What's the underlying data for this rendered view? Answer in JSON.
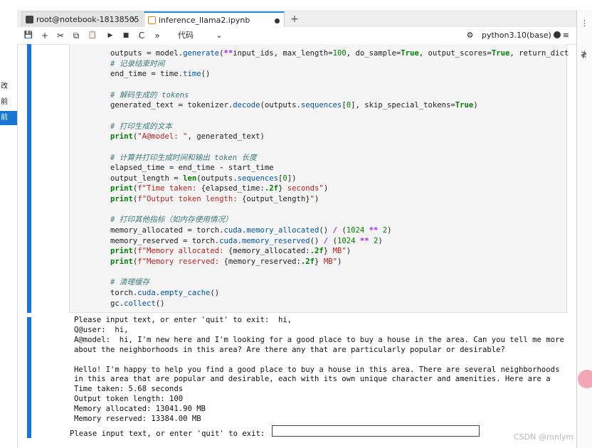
{
  "left_panel": {
    "items": [
      "改",
      "前",
      "前"
    ]
  },
  "tabs": [
    {
      "label": "root@notebook-18138505",
      "close": "×"
    },
    {
      "label": "inference_llama2.ipynb"
    }
  ],
  "new_tab_label": "+",
  "toolbar": {
    "save": "💾",
    "add": "+",
    "cut": "✂",
    "copy": "⧉",
    "paste": "📋",
    "run": "▶",
    "stop": "■",
    "restart": "C",
    "run_all": "»",
    "cell_type": "代码",
    "cell_type_arrow": "⌄",
    "kernel_icon": "⚙",
    "kernel_name": "python3.10(base)",
    "menu": "≡"
  },
  "right_edge": {
    "glyph1": "⋮",
    "glyph2": "≹"
  },
  "code_lines": [
    {
      "segs": [
        {
          "t": "outputs = model."
        },
        {
          "t": "generate",
          "c": "fn"
        },
        {
          "t": "("
        },
        {
          "t": "**",
          "c": "op"
        },
        {
          "t": "input_ids, max_length="
        },
        {
          "t": "100",
          "c": "num"
        },
        {
          "t": ", do_sample="
        },
        {
          "t": "True",
          "c": "kw"
        },
        {
          "t": ", output_scores="
        },
        {
          "t": "True",
          "c": "kw"
        },
        {
          "t": ", return_dict"
        }
      ]
    },
    {
      "segs": [
        {
          "t": "# 记录结束时间",
          "c": "cmt"
        }
      ]
    },
    {
      "segs": [
        {
          "t": "end_time = time."
        },
        {
          "t": "time",
          "c": "fn"
        },
        {
          "t": "()"
        }
      ]
    },
    {
      "segs": []
    },
    {
      "segs": [
        {
          "t": "# 解码生成的 tokens",
          "c": "cmt"
        }
      ]
    },
    {
      "segs": [
        {
          "t": "generated_text = tokenizer."
        },
        {
          "t": "decode",
          "c": "fn"
        },
        {
          "t": "(outputs."
        },
        {
          "t": "sequences",
          "c": "fn"
        },
        {
          "t": "["
        },
        {
          "t": "0",
          "c": "num"
        },
        {
          "t": "], skip_special_tokens="
        },
        {
          "t": "True",
          "c": "kw"
        },
        {
          "t": ")"
        }
      ]
    },
    {
      "segs": []
    },
    {
      "segs": [
        {
          "t": "# 打印生成的文本",
          "c": "cmt"
        }
      ]
    },
    {
      "segs": [
        {
          "t": "print",
          "c": "kw"
        },
        {
          "t": "("
        },
        {
          "t": "\"A@model: \"",
          "c": "str"
        },
        {
          "t": ", generated_text)"
        }
      ]
    },
    {
      "segs": []
    },
    {
      "segs": [
        {
          "t": "# 计算并打印生成时间和输出 token 长度",
          "c": "cmt"
        }
      ]
    },
    {
      "segs": [
        {
          "t": "elapsed_time = end_time "
        },
        {
          "t": "-",
          "c": "op"
        },
        {
          "t": " start_time"
        }
      ]
    },
    {
      "segs": [
        {
          "t": "output_length = "
        },
        {
          "t": "len",
          "c": "kw"
        },
        {
          "t": "(outputs."
        },
        {
          "t": "sequences",
          "c": "fn"
        },
        {
          "t": "["
        },
        {
          "t": "0",
          "c": "num"
        },
        {
          "t": "])"
        }
      ]
    },
    {
      "segs": [
        {
          "t": "print",
          "c": "kw"
        },
        {
          "t": "("
        },
        {
          "t": "f\"Time taken: ",
          "c": "str"
        },
        {
          "t": "{elapsed_time:"
        },
        {
          "t": ".2f",
          "c": "kw"
        },
        {
          "t": "}"
        },
        {
          "t": " seconds\"",
          "c": "str"
        },
        {
          "t": ")"
        }
      ]
    },
    {
      "segs": [
        {
          "t": "print",
          "c": "kw"
        },
        {
          "t": "("
        },
        {
          "t": "f\"Output token length: ",
          "c": "str"
        },
        {
          "t": "{output_length}"
        },
        {
          "t": "\"",
          "c": "str"
        },
        {
          "t": ")"
        }
      ]
    },
    {
      "segs": []
    },
    {
      "segs": [
        {
          "t": "# 打印其他指标（如内存使用情况）",
          "c": "cmt"
        }
      ]
    },
    {
      "segs": [
        {
          "t": "memory_allocated = torch."
        },
        {
          "t": "cuda",
          "c": "fn"
        },
        {
          "t": "."
        },
        {
          "t": "memory_allocated",
          "c": "fn"
        },
        {
          "t": "() "
        },
        {
          "t": "/",
          "c": "op"
        },
        {
          "t": " ("
        },
        {
          "t": "1024",
          "c": "num"
        },
        {
          "t": " "
        },
        {
          "t": "**",
          "c": "op"
        },
        {
          "t": " "
        },
        {
          "t": "2",
          "c": "num"
        },
        {
          "t": ")"
        }
      ]
    },
    {
      "segs": [
        {
          "t": "memory_reserved = torch."
        },
        {
          "t": "cuda",
          "c": "fn"
        },
        {
          "t": "."
        },
        {
          "t": "memory_reserved",
          "c": "fn"
        },
        {
          "t": "() "
        },
        {
          "t": "/",
          "c": "op"
        },
        {
          "t": " ("
        },
        {
          "t": "1024",
          "c": "num"
        },
        {
          "t": " "
        },
        {
          "t": "**",
          "c": "op"
        },
        {
          "t": " "
        },
        {
          "t": "2",
          "c": "num"
        },
        {
          "t": ")"
        }
      ]
    },
    {
      "segs": [
        {
          "t": "print",
          "c": "kw"
        },
        {
          "t": "("
        },
        {
          "t": "f\"Memory allocated: ",
          "c": "str"
        },
        {
          "t": "{memory_allocated:"
        },
        {
          "t": ".2f",
          "c": "kw"
        },
        {
          "t": "}"
        },
        {
          "t": " MB\"",
          "c": "str"
        },
        {
          "t": ")"
        }
      ]
    },
    {
      "segs": [
        {
          "t": "print",
          "c": "kw"
        },
        {
          "t": "("
        },
        {
          "t": "f\"Memory reserved: ",
          "c": "str"
        },
        {
          "t": "{memory_reserved:"
        },
        {
          "t": ".2f",
          "c": "kw"
        },
        {
          "t": "}"
        },
        {
          "t": " MB\"",
          "c": "str"
        },
        {
          "t": ")"
        }
      ]
    },
    {
      "segs": []
    },
    {
      "segs": [
        {
          "t": "# 清理缓存",
          "c": "cmt"
        }
      ]
    },
    {
      "segs": [
        {
          "t": "torch."
        },
        {
          "t": "cuda",
          "c": "fn"
        },
        {
          "t": "."
        },
        {
          "t": "empty_cache",
          "c": "fn"
        },
        {
          "t": "()"
        }
      ]
    },
    {
      "segs": [
        {
          "t": "gc."
        },
        {
          "t": "collect",
          "c": "fn"
        },
        {
          "t": "()"
        }
      ]
    }
  ],
  "output_lines": [
    "Please input text, or enter 'quit' to exit:  hi,",
    "Q@user:  hi,",
    "A@model:  hi, I'm new here and I'm looking for a good place to buy a house in the area. Can you tell me more",
    "about the neighborhoods in this area? Are there any that are particularly popular or desirable?",
    "",
    "Hello! I'm happy to help you find a good place to buy a house in this area. There are several neighborhoods",
    "in this area that are popular and desirable, each with its own unique character and amenities. Here are a",
    "Time taken: 5.68 seconds",
    "Output token length: 100",
    "Memory allocated: 13041.90 MB",
    "Memory reserved: 13384.00 MB"
  ],
  "prompt": {
    "text": "Please input text, or enter 'quit' to exit: ",
    "value": ""
  },
  "watermark": "CSDN @ronlym"
}
